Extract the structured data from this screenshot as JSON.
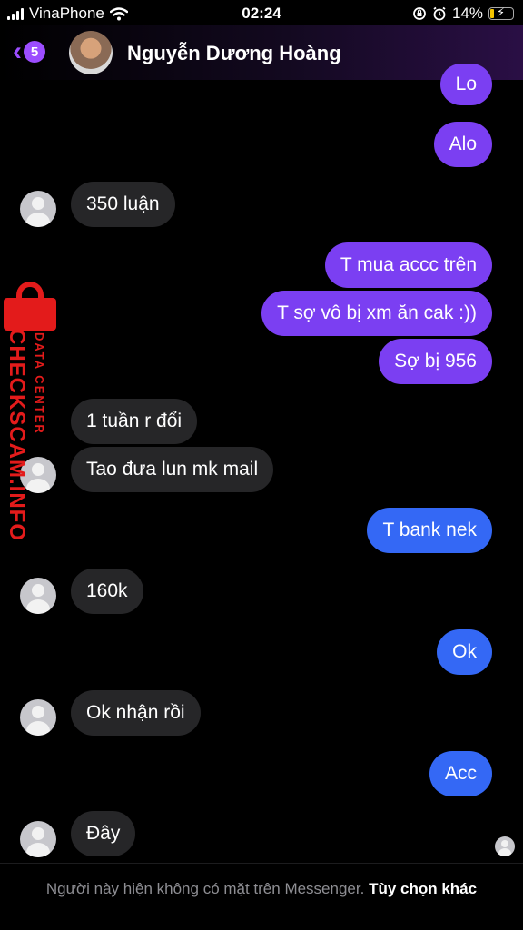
{
  "status_bar": {
    "carrier": "VinaPhone",
    "time": "02:24",
    "battery_percent": "14%",
    "icons": [
      "signal-bars-icon",
      "wifi-icon",
      "orientation-lock-icon",
      "alarm-icon",
      "battery-charging-icon"
    ]
  },
  "header": {
    "back_badge": "5",
    "contact_name": "Nguyễn Dương Hoàng"
  },
  "watermark": {
    "main": "CHECKSCAM.INFO",
    "sub": "DATA CENTER"
  },
  "messages": [
    {
      "sender": "me",
      "text": "Lo"
    },
    {
      "sender": "me",
      "text": "Alo"
    },
    {
      "sender": "them",
      "text": "350 luận"
    },
    {
      "sender": "me",
      "text": "T mua accc trên"
    },
    {
      "sender": "me",
      "text": "T sợ vô bị xm ăn cak :))"
    },
    {
      "sender": "me",
      "text": "Sợ bị 956"
    },
    {
      "sender": "them",
      "text": "1 tuần r đổi"
    },
    {
      "sender": "them",
      "text": "Tao đưa lun mk mail"
    },
    {
      "sender": "me",
      "text": "T bank nek"
    },
    {
      "sender": "them",
      "text": "160k"
    },
    {
      "sender": "me",
      "text": "Ok"
    },
    {
      "sender": "them",
      "text": "Ok nhận rồi"
    },
    {
      "sender": "me",
      "text": "Acc"
    },
    {
      "sender": "them",
      "text": "Đây"
    }
  ],
  "colors": {
    "accent_purple": "#9c4dff",
    "outgoing_purple": "#7b3ff2",
    "outgoing_blue": "#3468f5",
    "incoming_gray": "#262628",
    "watermark_red": "#e31b1b"
  },
  "footer": {
    "note": "Người này hiện không có mặt trên Messenger.",
    "action": "Tùy chọn khác"
  }
}
